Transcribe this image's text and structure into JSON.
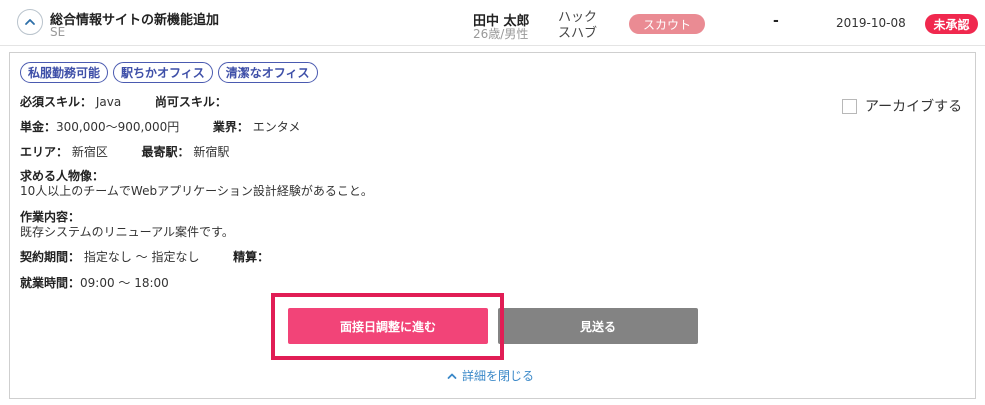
{
  "header": {
    "title": "総合情報サイトの新機能追加",
    "category": "SE",
    "person_name": "田中 太郎",
    "person_meta": "26歳/男性",
    "company": "ハック スハブ",
    "scout_badge": "スカウト",
    "dash": "-",
    "date": "2019-10-08",
    "status_badge": "未承認"
  },
  "detail": {
    "tags": [
      "私服勤務可能",
      "駅ちかオフィス",
      "清潔なオフィス"
    ],
    "required_skill_label": "必須スキル：",
    "required_skill_value": "Java",
    "preferred_skill_label": "尚可スキル：",
    "preferred_skill_value": "",
    "price_label": "単金：",
    "price_value": "300,000〜900,000円",
    "industry_label": "業界：",
    "industry_value": "エンタメ",
    "area_label": "エリア：",
    "area_value": "新宿区",
    "station_label": "最寄駅：",
    "station_value": "新宿駅",
    "persona_label": "求める人物像：",
    "persona_value": "10人以上のチームでWebアプリケーション設計経験があること。",
    "work_label": "作業内容：",
    "work_value": "既存システムのリニューアル案件です。",
    "contract_label": "契約期間：",
    "contract_value": "指定なし 〜 指定なし",
    "settlement_label": "精算：",
    "settlement_value": "",
    "hours_label": "就業時間：",
    "hours_value": "09:00 〜 18:00",
    "archive_label": "アーカイブする",
    "interview_button": "面接日調整に進む",
    "pass_button": "見送る",
    "close_link": "詳細を閉じる"
  },
  "icons": {
    "collapse": "chevron-up-icon",
    "close": "chevron-up-icon"
  },
  "colors": {
    "scout_badge": "#ea8b93",
    "status_badge": "#f0284e",
    "primary_button": "#f24478",
    "secondary_button": "#838383",
    "tag_border": "#4a5ab0",
    "link": "#3a88c8",
    "highlight": "#e11d55"
  }
}
